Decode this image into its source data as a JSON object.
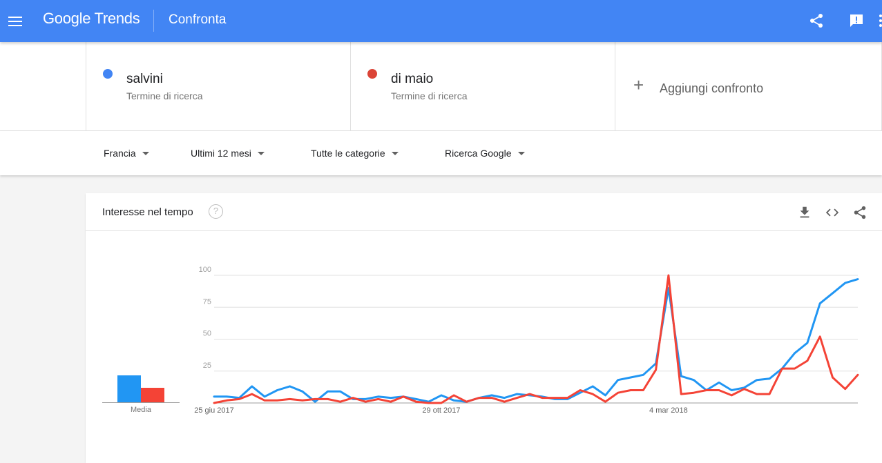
{
  "header": {
    "app_name": "Google Trends",
    "page_title": "Confronta",
    "icons": [
      "menu-icon",
      "share-icon",
      "feedback-icon",
      "more-vert-icon"
    ],
    "background": "#4285f4"
  },
  "terms": [
    {
      "name": "salvini",
      "type": "Termine di ricerca",
      "color": "#4285f4"
    },
    {
      "name": "di maio",
      "type": "Termine di ricerca",
      "color": "#db4437"
    }
  ],
  "add_comparison_label": "Aggiungi confronto",
  "filters": {
    "region": "Francia",
    "time": "Ultimi 12 mesi",
    "category": "Tutte le categorie",
    "search_type": "Ricerca Google"
  },
  "card": {
    "title": "Interesse nel tempo",
    "help_symbol": "?",
    "icons": [
      "download-icon",
      "embed-icon",
      "share-icon"
    ]
  },
  "averages": {
    "label": "Media",
    "values": [
      17,
      9
    ]
  },
  "chart_data": {
    "type": "line",
    "x_ticks": [
      "25 giu 2017",
      "29 ott 2017",
      "4 mar 2018"
    ],
    "x_tick_indices": [
      0,
      18,
      36
    ],
    "y_ticks": [
      100,
      75,
      50,
      25
    ],
    "ylim": [
      0,
      100
    ],
    "grid": true,
    "series": [
      {
        "name": "salvini",
        "color": "#2196f3",
        "values": [
          5,
          5,
          4,
          13,
          5,
          10,
          13,
          9,
          1,
          9,
          9,
          3,
          3,
          5,
          4,
          5,
          3,
          1,
          6,
          2,
          1,
          4,
          6,
          4,
          7,
          6,
          5,
          3,
          3,
          8,
          13,
          6,
          18,
          20,
          22,
          31,
          90,
          21,
          18,
          10,
          16,
          10,
          12,
          18,
          19,
          27,
          39,
          47,
          78,
          86,
          94,
          97
        ]
      },
      {
        "name": "di maio",
        "color": "#f44336",
        "values": [
          0,
          2,
          3,
          7,
          2,
          2,
          3,
          2,
          3,
          3,
          1,
          4,
          1,
          3,
          1,
          5,
          1,
          0,
          0,
          6,
          1,
          4,
          4,
          1,
          4,
          7,
          4,
          4,
          4,
          10,
          7,
          1,
          8,
          10,
          10,
          26,
          100,
          7,
          8,
          10,
          10,
          6,
          11,
          7,
          7,
          27,
          27,
          33,
          52,
          20,
          11,
          22
        ]
      }
    ]
  }
}
